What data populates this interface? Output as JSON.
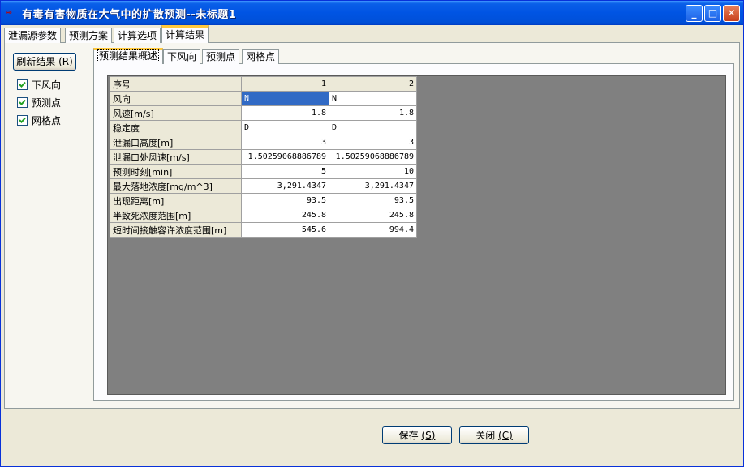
{
  "window": {
    "title": "有毒有害物质在大气中的扩散预测--未标题1",
    "buttons": {
      "minimize": "_",
      "maximize": "□",
      "close": "✕"
    }
  },
  "top_tabs": [
    "泄漏源参数",
    "预测方案",
    "计算选项",
    "计算结果"
  ],
  "top_tabs_active": "计算结果",
  "left_panel": {
    "refresh_label": "刷新结果",
    "refresh_hotkey": "(R)",
    "checkboxes": [
      {
        "label": "下风向",
        "checked": true
      },
      {
        "label": "预测点",
        "checked": true
      },
      {
        "label": "网格点",
        "checked": true
      }
    ]
  },
  "inner_tabs": [
    "预测结果概述",
    "下风向",
    "预测点",
    "网格点"
  ],
  "inner_tabs_active": "预测结果概述",
  "grid": {
    "header": {
      "label": "序号",
      "cols": [
        "1",
        "2"
      ]
    },
    "rows": [
      {
        "label": "风向",
        "v1": "N",
        "v2": "N"
      },
      {
        "label": "风速[m/s]",
        "v1": "1.8",
        "v2": "1.8"
      },
      {
        "label": "稳定度",
        "v1": "D",
        "v2": "D"
      },
      {
        "label": "泄漏口高度[m]",
        "v1": "3",
        "v2": "3"
      },
      {
        "label": "泄漏口处风速[m/s]",
        "v1": "1.50259068886789",
        "v2": "1.50259068886789"
      },
      {
        "label": "预测时刻[min]",
        "v1": "5",
        "v2": "10"
      },
      {
        "label": "最大落地浓度[mg/m^3]",
        "v1": "3,291.4347",
        "v2": "3,291.4347"
      },
      {
        "label": "出现距离[m]",
        "v1": "93.5",
        "v2": "93.5"
      },
      {
        "label": "半致死浓度范围[m]",
        "v1": "245.8",
        "v2": "245.8"
      },
      {
        "label": "短时间接触容许浓度范围[m]",
        "v1": "545.6",
        "v2": "994.4"
      }
    ]
  },
  "footer": {
    "save_label": "保存",
    "save_hotkey": "(S)",
    "close_label": "关闭",
    "close_hotkey": "(C)"
  },
  "colors": {
    "titlebar": "#0054e3",
    "selection": "#316ac5",
    "grid_bg": "#808080",
    "tab_accent": "#ffc83c"
  }
}
